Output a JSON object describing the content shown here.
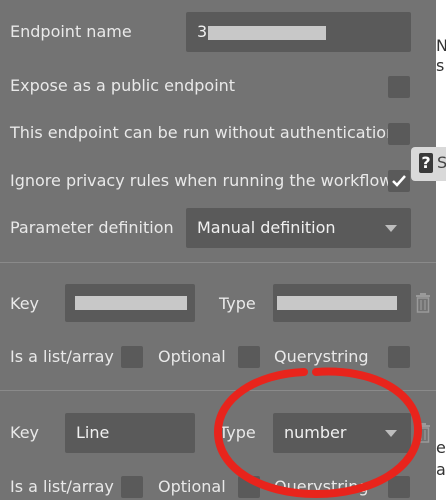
{
  "endpoint": {
    "name_label": "Endpoint name",
    "name_value_visible": "3",
    "expose_label": "Expose as a public endpoint",
    "no_auth_label": "This endpoint can be run without authentication",
    "ignore_privacy_label": "Ignore privacy rules when running the workflow",
    "param_def_label": "Parameter definition",
    "param_def_value": "Manual definition"
  },
  "params": [
    {
      "key_label": "Key",
      "key_value": "",
      "type_label": "Type",
      "type_value": "",
      "list_label": "Is a list/array",
      "optional_label": "Optional",
      "querystring_label": "Querystring"
    },
    {
      "key_label": "Key",
      "key_value": "Line",
      "type_label": "Type",
      "type_value": "number",
      "list_label": "Is a list/array",
      "optional_label": "Optional",
      "querystring_label": "Querystring"
    }
  ],
  "help": {
    "badge_text": "S"
  },
  "edge_text": [
    "N",
    "s",
    "e",
    "a"
  ],
  "colors": {
    "panel_bg": "#737373",
    "input_bg": "#5a5a5a",
    "annotation_red": "#e8241c"
  },
  "icons": [
    "check-icon",
    "chevron-down-icon",
    "trash-icon",
    "help-icon"
  ]
}
